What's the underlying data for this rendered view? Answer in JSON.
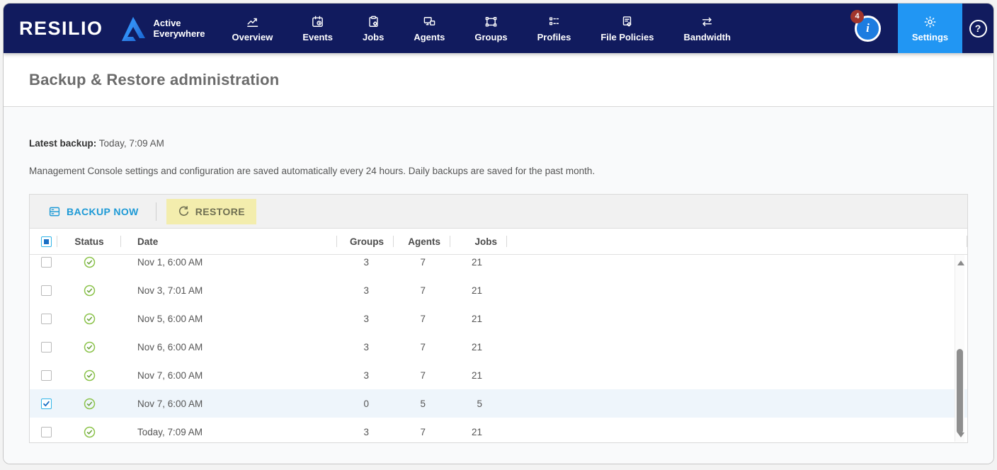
{
  "brand": {
    "name": "RESILIO",
    "product_line1": "Active",
    "product_line2": "Everywhere"
  },
  "nav": {
    "items": [
      {
        "label": "Overview",
        "icon": "line-chart"
      },
      {
        "label": "Events",
        "icon": "calendar-clock"
      },
      {
        "label": "Jobs",
        "icon": "clipboard-gear"
      },
      {
        "label": "Agents",
        "icon": "monitors"
      },
      {
        "label": "Groups",
        "icon": "selection-frame"
      },
      {
        "label": "Profiles",
        "icon": "list-settings"
      },
      {
        "label": "File Policies",
        "icon": "document-gear"
      },
      {
        "label": "Bandwidth",
        "icon": "arrows-left-right"
      }
    ],
    "settings_label": "Settings",
    "notification_count": "4",
    "info_glyph": "i",
    "help_glyph": "?"
  },
  "page": {
    "title": "Backup & Restore administration"
  },
  "summary": {
    "latest_backup_label": "Latest backup:",
    "latest_backup_value": "Today, 7:09 AM",
    "description": "Management Console settings and configuration are saved automatically every 24 hours. Daily backups are saved for the past month."
  },
  "toolbar": {
    "backup_label": "BACKUP NOW",
    "restore_label": "RESTORE"
  },
  "table": {
    "columns": [
      "Status",
      "Date",
      "Groups",
      "Agents",
      "Jobs"
    ],
    "rows": [
      {
        "status": "success",
        "date": "Nov 1, 6:00 AM",
        "groups": 3,
        "agents": 7,
        "jobs": 21,
        "selected": false
      },
      {
        "status": "success",
        "date": "Nov 3, 7:01 AM",
        "groups": 3,
        "agents": 7,
        "jobs": 21,
        "selected": false
      },
      {
        "status": "success",
        "date": "Nov 5, 6:00 AM",
        "groups": 3,
        "agents": 7,
        "jobs": 21,
        "selected": false
      },
      {
        "status": "success",
        "date": "Nov 6, 6:00 AM",
        "groups": 3,
        "agents": 7,
        "jobs": 21,
        "selected": false
      },
      {
        "status": "success",
        "date": "Nov 7, 6:00 AM",
        "groups": 3,
        "agents": 7,
        "jobs": 21,
        "selected": false
      },
      {
        "status": "success",
        "date": "Nov 7, 6:00 AM",
        "groups": 0,
        "agents": 5,
        "jobs": 5,
        "selected": true
      },
      {
        "status": "success",
        "date": "Today, 7:09 AM",
        "groups": 3,
        "agents": 7,
        "jobs": 21,
        "selected": false
      }
    ]
  },
  "icons": {
    "status-success": "green circle with checkmark",
    "backup-now": "storage drive",
    "restore": "circular redo arrow",
    "settings": "gear",
    "info": "i in filled circle",
    "help": "? in outlined circle"
  },
  "colors": {
    "navbar": "#111b5e",
    "settings_active": "#2196f3",
    "accent_cyan": "#1e9ad6",
    "restore_highlight": "#f3edad",
    "status_green": "#8bc34a",
    "badge_red": "#a1352c",
    "selected_row": "#eef5fb"
  }
}
